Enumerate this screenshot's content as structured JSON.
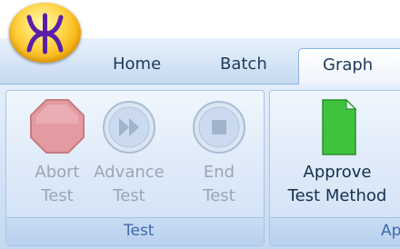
{
  "app_menu": {
    "icon": "yellow-orb-logo-icon"
  },
  "tabs": [
    {
      "label": "Home",
      "active": false
    },
    {
      "label": "Batch",
      "active": false
    },
    {
      "label": "Graph",
      "active": true
    }
  ],
  "groups": {
    "test": {
      "label": "Test",
      "buttons": [
        {
          "line1": "Abort",
          "line2": "Test",
          "icon": "stop-octagon-icon",
          "enabled": false
        },
        {
          "line1": "Advance",
          "line2": "Test",
          "icon": "fast-forward-icon",
          "enabled": false
        },
        {
          "line1": "End",
          "line2": "Test",
          "icon": "stop-square-icon",
          "enabled": false
        }
      ]
    },
    "approve": {
      "label": "App",
      "buttons": [
        {
          "line1": "Approve",
          "line2": "Test Method",
          "icon": "green-document-icon",
          "enabled": true
        }
      ]
    }
  },
  "colors": {
    "accent_text": "#1e395b",
    "disabled_text": "#9aa6b4",
    "group_label": "#3e6aaa",
    "abort_fill": "#e39aa0",
    "approve_doc": "#3fc33f"
  }
}
